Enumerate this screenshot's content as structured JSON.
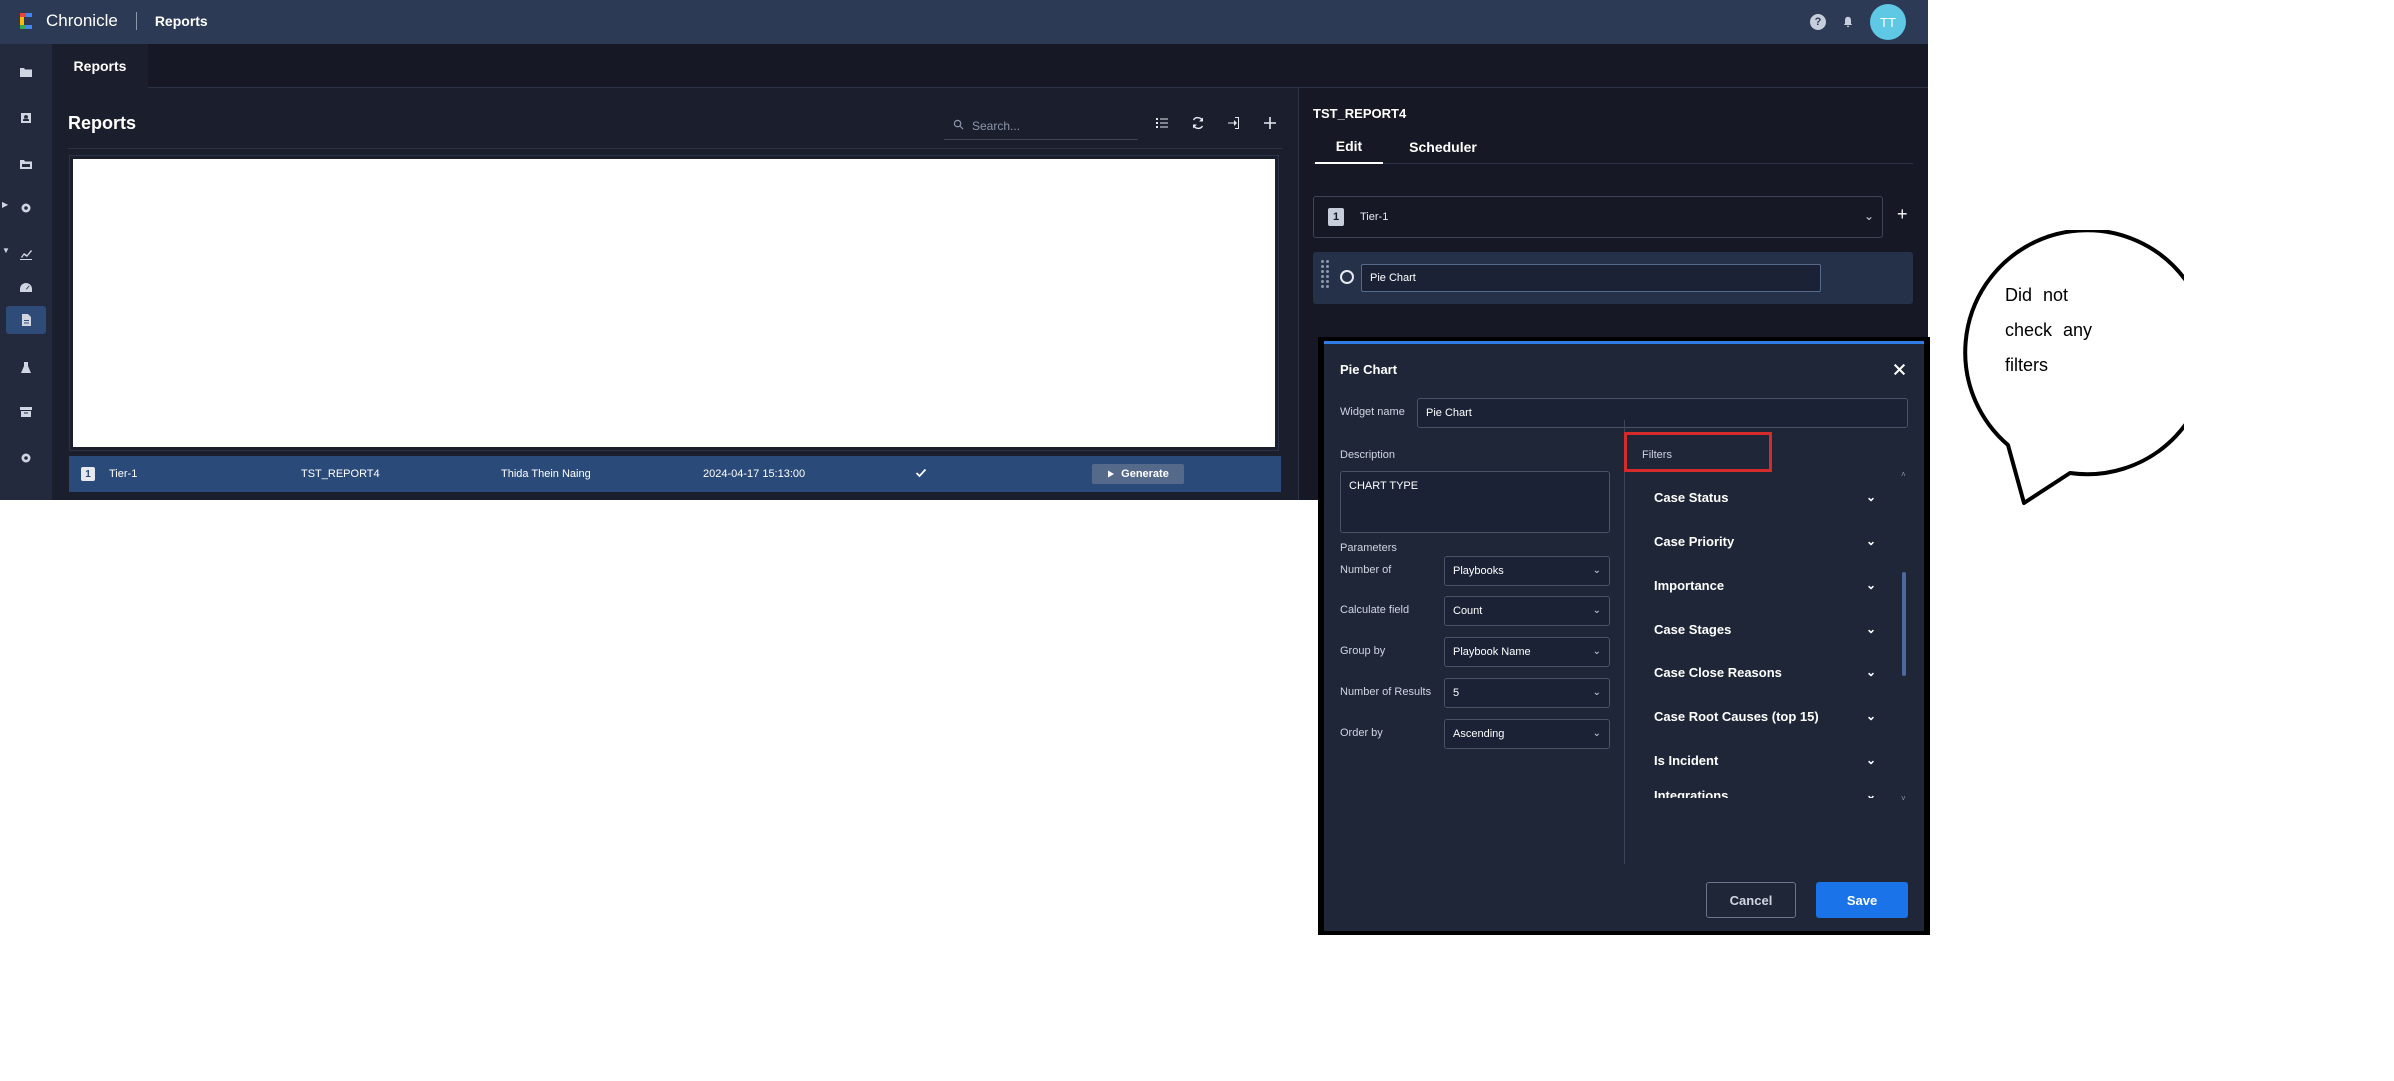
{
  "app": {
    "brand": "Chronicle",
    "page": "Reports",
    "help_icon": "?",
    "avatar_initials": "TT"
  },
  "subheader": {
    "tab": "Reports"
  },
  "left_rail": {
    "icons": [
      "folder-icon",
      "id-badge-icon",
      "folder-open-icon",
      "gear-icon",
      "chart-line-icon",
      "dashboard-icon",
      "report-icon",
      "flask-icon",
      "archive-icon",
      "settings-icon"
    ]
  },
  "reports": {
    "title": "Reports",
    "search_placeholder": "Search...",
    "row": {
      "badge": "1",
      "tier": "Tier-1",
      "name": "TST_REPORT4",
      "owner": "Thida Thein Naing",
      "date": "2024-04-17 15:13:00",
      "generate_label": "Generate"
    }
  },
  "editor": {
    "title": "TST_REPORT4",
    "tabs": [
      "Edit",
      "Scheduler"
    ],
    "tier_badge": "1",
    "tier_label": "Tier-1",
    "widget_name": "Pie Chart"
  },
  "modal": {
    "title": "Pie Chart",
    "widget_name_label": "Widget name",
    "widget_name_value": "Pie Chart",
    "description_label": "Description",
    "description_value": "CHART TYPE",
    "parameters_label": "Parameters",
    "params": [
      {
        "label": "Number of",
        "value": "Playbooks"
      },
      {
        "label": "Calculate field",
        "value": "Count"
      },
      {
        "label": "Group by",
        "value": "Playbook Name"
      },
      {
        "label": "Number of Results",
        "value": "5"
      },
      {
        "label": "Order by",
        "value": "Ascending"
      }
    ],
    "filters_label": "Filters",
    "filters": [
      "Case Status",
      "Case Priority",
      "Importance",
      "Case Stages",
      "Case Close Reasons",
      "Case Root Causes (top 15)",
      "Is Incident",
      "Integrations"
    ],
    "cancel_label": "Cancel",
    "save_label": "Save"
  },
  "annotation": {
    "line1": "Did not",
    "line2": "check any",
    "line3": "filters"
  }
}
